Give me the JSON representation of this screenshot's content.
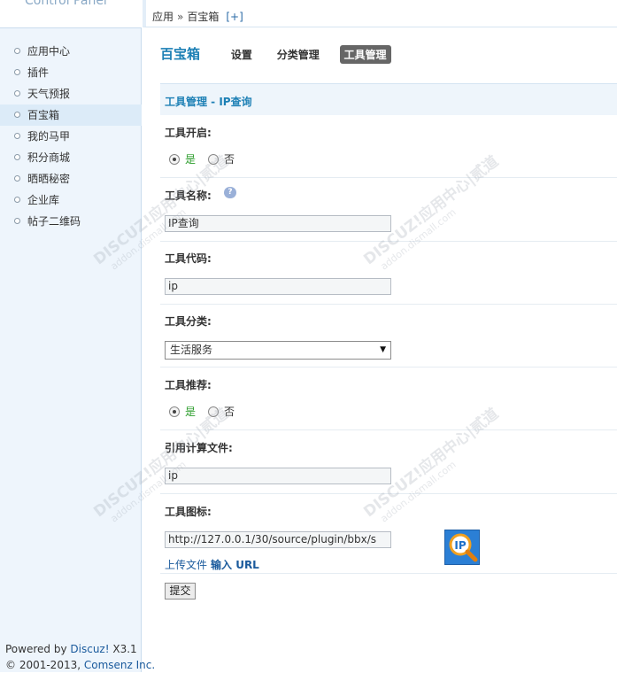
{
  "brand": {
    "title": "Control Panel"
  },
  "sidebar": {
    "items": [
      {
        "label": "应用中心",
        "active": false
      },
      {
        "label": "插件",
        "active": false
      },
      {
        "label": "天气预报",
        "active": false
      },
      {
        "label": "百宝箱",
        "active": true
      },
      {
        "label": "我的马甲",
        "active": false
      },
      {
        "label": "积分商城",
        "active": false
      },
      {
        "label": "晒晒秘密",
        "active": false
      },
      {
        "label": "企业库",
        "active": false
      },
      {
        "label": "帖子二维码",
        "active": false
      }
    ]
  },
  "footer": {
    "powered_prefix": "Powered by",
    "powered_link": "Discuz!",
    "version": "X3.1",
    "copyright": "© 2001-2013,",
    "company_link": "Comsenz Inc."
  },
  "breadcrumb": {
    "root": "应用",
    "separator": "»",
    "current": "百宝箱",
    "add": "[+]"
  },
  "main": {
    "title": "百宝箱",
    "tabs": [
      {
        "label": "设置",
        "active": false
      },
      {
        "label": "分类管理",
        "active": false
      },
      {
        "label": "工具管理",
        "active": true
      }
    ],
    "section_title": "工具管理 - IP查询"
  },
  "form": {
    "enable": {
      "label": "工具开启:",
      "options": [
        "是",
        "否"
      ],
      "selected": "是"
    },
    "name": {
      "label": "工具名称:",
      "value": "IP查询",
      "help_icon": "question-bubble-icon"
    },
    "code": {
      "label": "工具代码:",
      "value": "ip"
    },
    "category": {
      "label": "工具分类:",
      "selected": "生活服务"
    },
    "recommend": {
      "label": "工具推荐:",
      "options": [
        "是",
        "否"
      ],
      "selected": "是"
    },
    "calc_file": {
      "label": "引用计算文件:",
      "value": "ip"
    },
    "icon": {
      "label": "工具图标:",
      "value": "http://127.0.0.1/30/source/plugin/bbx/s",
      "preview_text": "IP",
      "upload_label": "上传文件",
      "url_label": "输入 URL"
    },
    "submit_label": "提交"
  },
  "watermark": {
    "brand": "DISCUZ!应用中心|贰道",
    "domain": "addon.dismall.com"
  },
  "colors": {
    "accent": "#1d80b5",
    "sidebar_bg": "#eef5fc",
    "section_bg": "#eef5fb",
    "link": "#1a5a9c"
  }
}
